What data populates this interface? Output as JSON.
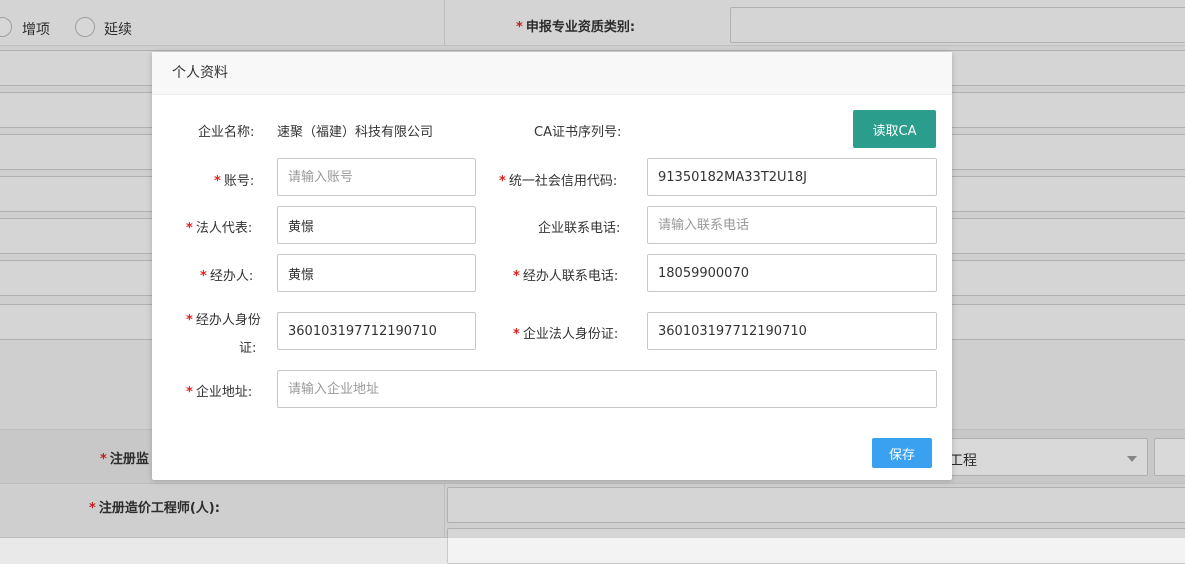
{
  "background": {
    "radio_options": [
      "增项",
      "延续"
    ],
    "qualification_label": "申报专业资质类别:",
    "supervision_label_partial": "注册监",
    "cost_engineer_label": "注册造价工程师(人):",
    "select_partial_value": "工程"
  },
  "modal": {
    "title": "个人资料",
    "company_name_label": "企业名称:",
    "company_name_value": "速聚（福建）科技有限公司",
    "ca_serial_label": "CA证书序列号:",
    "read_ca_button": "读取CA",
    "account_label": "账号:",
    "account_placeholder": "请输入账号",
    "credit_code_label": "统一社会信用代码:",
    "credit_code_value": "91350182MA33T2U18J",
    "legal_rep_label": "法人代表:",
    "legal_rep_value": "黄憬",
    "company_phone_label": "企业联系电话:",
    "company_phone_placeholder": "请输入联系电话",
    "agent_label": "经办人:",
    "agent_value": "黄憬",
    "agent_phone_label": "经办人联系电话:",
    "agent_phone_value": "18059900070",
    "agent_id_label_line1": "经办人身份",
    "agent_id_label_line2": "证:",
    "agent_id_value": "360103197712190710",
    "legal_id_label": "企业法人身份证:",
    "legal_id_value": "360103197712190710",
    "address_label": "企业地址:",
    "address_placeholder": "请输入企业地址",
    "save_button": "保存"
  },
  "colors": {
    "required_mark": "#e02020",
    "ca_button": "#2a9d8c",
    "save_button": "#3aa0f0"
  }
}
